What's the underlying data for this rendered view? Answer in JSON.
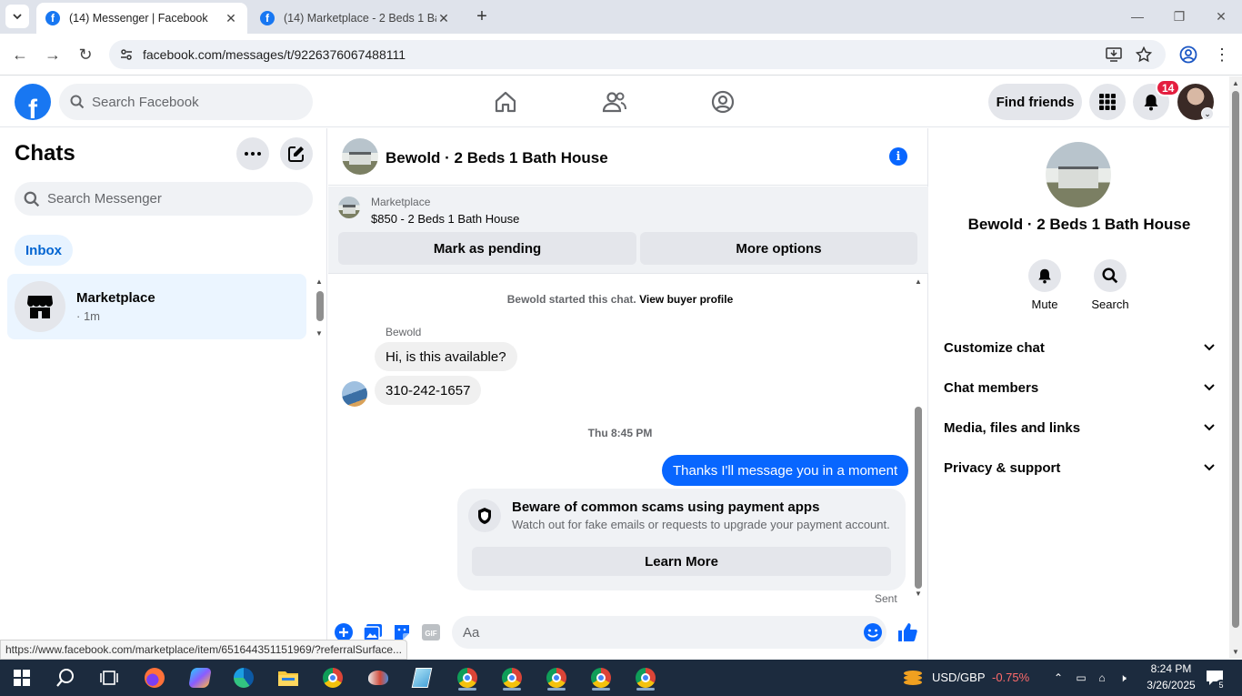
{
  "browser": {
    "tabs": [
      {
        "title": "(14) Messenger | Facebook",
        "active": true
      },
      {
        "title": "(14) Marketplace - 2 Beds 1 Bath",
        "active": false
      }
    ],
    "url": "facebook.com/messages/t/9226376067488111",
    "status_url": "https://www.facebook.com/marketplace/item/651644351151969/?referralSurface..."
  },
  "fb_nav": {
    "search_placeholder": "Search Facebook",
    "find_friends_label": "Find friends",
    "notification_count": "14",
    "brand_color": "#1877f2"
  },
  "chats": {
    "title": "Chats",
    "search_placeholder": "Search Messenger",
    "filter_label": "Inbox",
    "items": [
      {
        "name": "Marketplace",
        "meta": "· 1m"
      }
    ]
  },
  "conversation": {
    "title": "Bewold · 2 Beds 1 Bath House",
    "marketplace_label": "Marketplace",
    "listing_text": "$850 - 2 Beds 1 Bath House",
    "mark_pending_label": "Mark as pending",
    "more_options_label": "More options",
    "started_text": "Bewold started this chat.",
    "view_profile_label": "View buyer profile",
    "sender_name": "Bewold",
    "incoming_messages": [
      "Hi, is this available?",
      "310-242-1657"
    ],
    "timestamp": "Thu 8:45 PM",
    "outgoing_message": "Thanks I'll message you in a moment",
    "scam_title": "Beware of common scams using payment apps",
    "scam_desc": "Watch out for fake emails or requests to upgrade your payment account.",
    "learn_more_label": "Learn More",
    "sent_label": "Sent",
    "composer_placeholder": "Aa",
    "gif_label": "GIF",
    "accent_color": "#0866ff"
  },
  "details": {
    "name": "Bewold · 2 Beds 1 Bath House",
    "actions": [
      {
        "label": "Mute",
        "icon": "bell-icon"
      },
      {
        "label": "Search",
        "icon": "search-icon"
      }
    ],
    "sections": [
      "Customize chat",
      "Chat members",
      "Media, files and links",
      "Privacy & support"
    ]
  },
  "taskbar": {
    "currency_pair": "USD/GBP",
    "currency_change": "-0.75%",
    "time": "8:24 PM",
    "date": "3/26/2025",
    "notification_count": "5"
  }
}
